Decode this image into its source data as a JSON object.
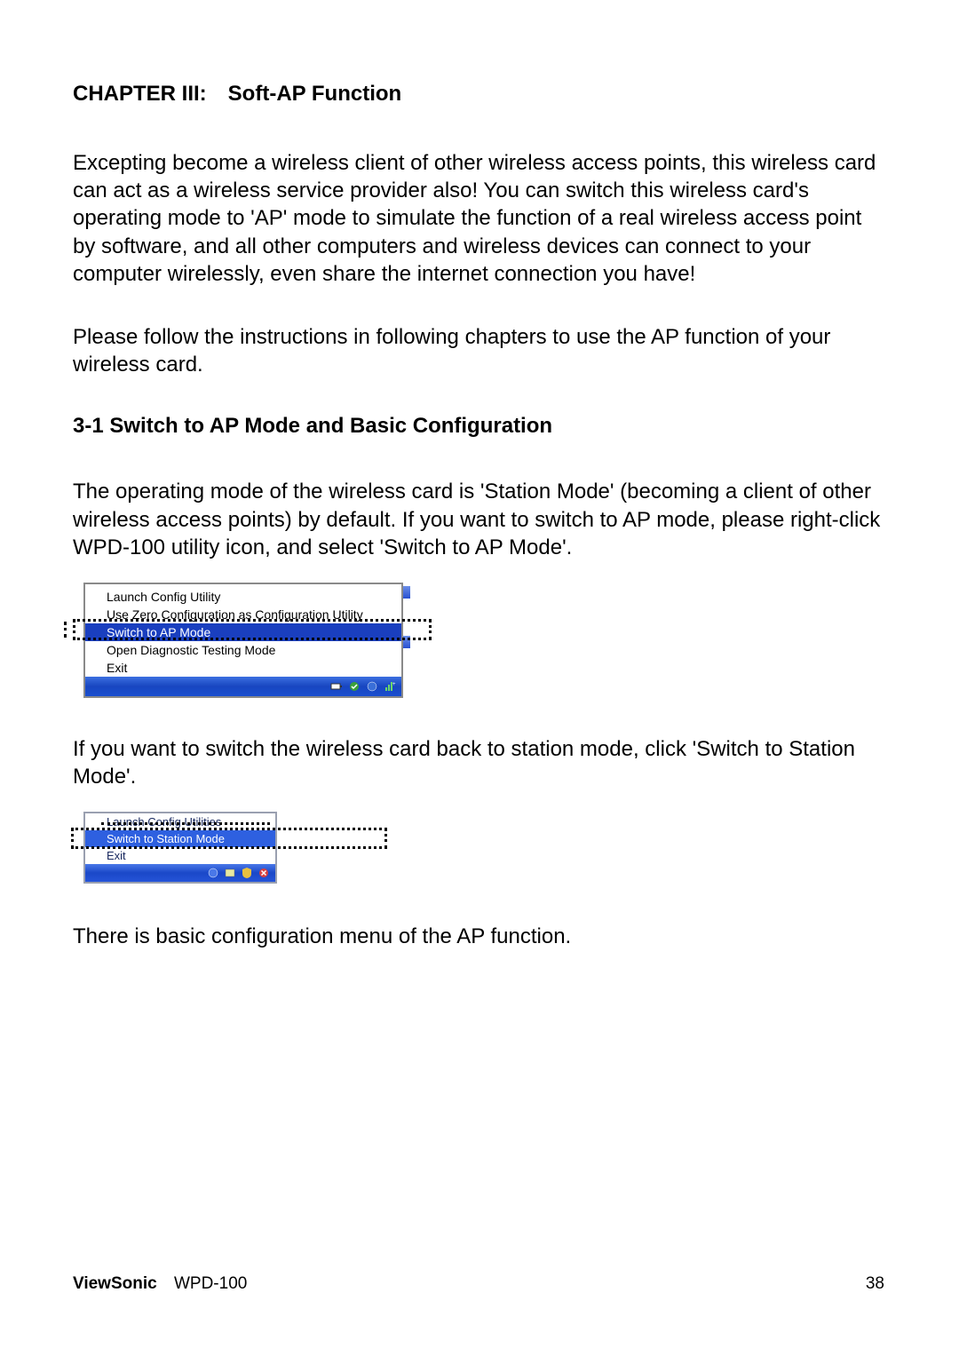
{
  "chapter_title": "CHAPTER III: Soft-AP Function",
  "para1": "Excepting become a wireless client of other wireless access points, this wireless card can act as a wireless service provider also! You can switch this wireless card's operating mode to 'AP' mode to simulate the function of a real wireless access point by software, and all other computers and wireless devices can connect to your computer wirelessly, even share the internet connection you have!",
  "para2": "Please follow the instructions in following chapters to use the AP function of your wireless card.",
  "section_title": "3-1 Switch to AP Mode and Basic Configuration",
  "para3": "The operating mode of the wireless card is 'Station Mode' (becoming a client of other wireless access points) by default. If you want to switch to AP mode, please right-click WPD-100 utility icon, and select 'Switch to AP Mode'.",
  "menu1": {
    "items": [
      "Launch Config Utility",
      "Use Zero Configuration as Configuration Utility",
      "Switch to AP Mode",
      "Open Diagnostic Testing Mode",
      "Exit"
    ],
    "highlighted_index": 2
  },
  "para4": "If you want to switch the wireless card back to station mode, click 'Switch to Station Mode'.",
  "menu2": {
    "items": [
      "Launch Config Utilities",
      "Switch to Station Mode",
      "Exit"
    ],
    "highlighted_index": 1
  },
  "para5": "There is basic configuration menu of the AP function.",
  "footer": {
    "brand": "ViewSonic",
    "model": "WPD-100",
    "page_number": "38"
  }
}
